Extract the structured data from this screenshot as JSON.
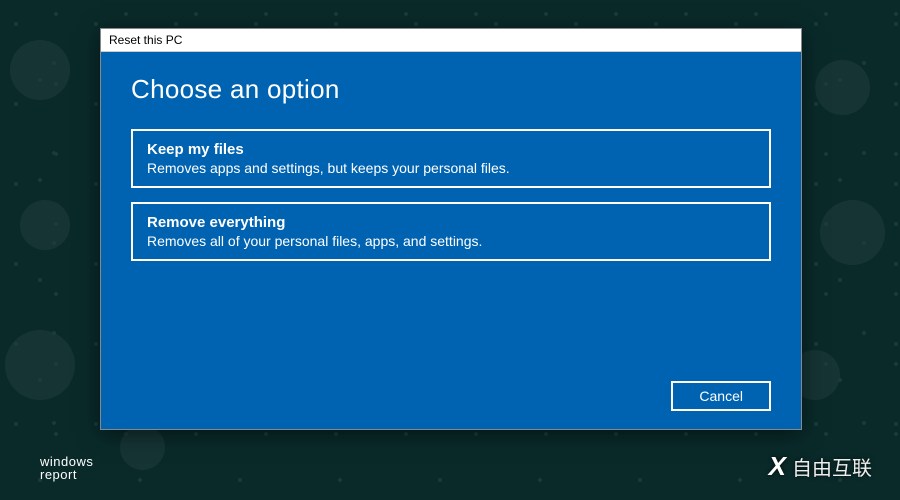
{
  "dialog": {
    "title": "Reset this PC",
    "heading": "Choose an option",
    "options": [
      {
        "title": "Keep my files",
        "desc": "Removes apps and settings, but keeps your personal files."
      },
      {
        "title": "Remove everything",
        "desc": "Removes all of your personal files, apps, and settings."
      }
    ],
    "cancel_label": "Cancel"
  },
  "watermarks": {
    "left_line1": "windows",
    "left_line2": "report",
    "right_text": "自由互联"
  }
}
